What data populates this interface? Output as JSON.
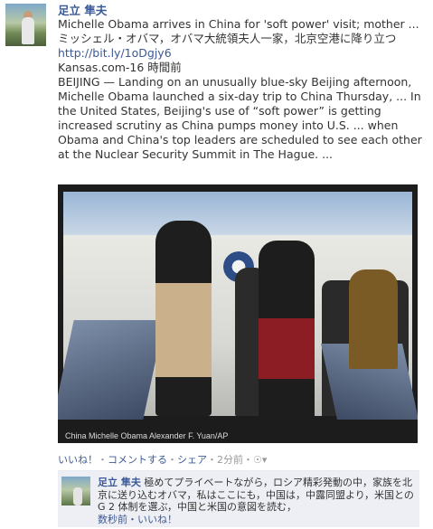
{
  "post": {
    "author": "足立 隼夫",
    "headline": "Michelle Obama arrives in China for 'soft power' visit; mother ...",
    "jp_title": "ミッシェル・オバマ，オバマ大統領夫人一家，北京空港に降り立つ",
    "link": "http://bit.ly/1oDgjy6",
    "source": "Kansas.com-16 時間前",
    "summary": "BEIJING — Landing on an unusually blue-sky Beijing afternoon, Michelle Obama launched a six-day trip to China Thursday, ... In the United States, Beijing's use of “soft power” is getting increased scrutiny as China pumps money into U.S. ... when Obama and China's top leaders are scheduled to see each other at the Nuclear Security Summit in The Hague. ...",
    "photo_caption": "China Michelle Obama Alexander F. Yuan/AP"
  },
  "actions": {
    "like": "いいね！",
    "comment": "コメントする",
    "share": "シェア",
    "time": "2分前",
    "sep": "・"
  },
  "comment": {
    "author": "足立 隼夫",
    "text": "極めてプライベートながら，ロシア精彩発動の中，家族を北京に送り込むオバマ，私はここにも，中国は，中露同盟より，米国との G 2 体制を選ぶ，中国と米国の意図を読む，",
    "meta": "数秒前・いいね！"
  }
}
